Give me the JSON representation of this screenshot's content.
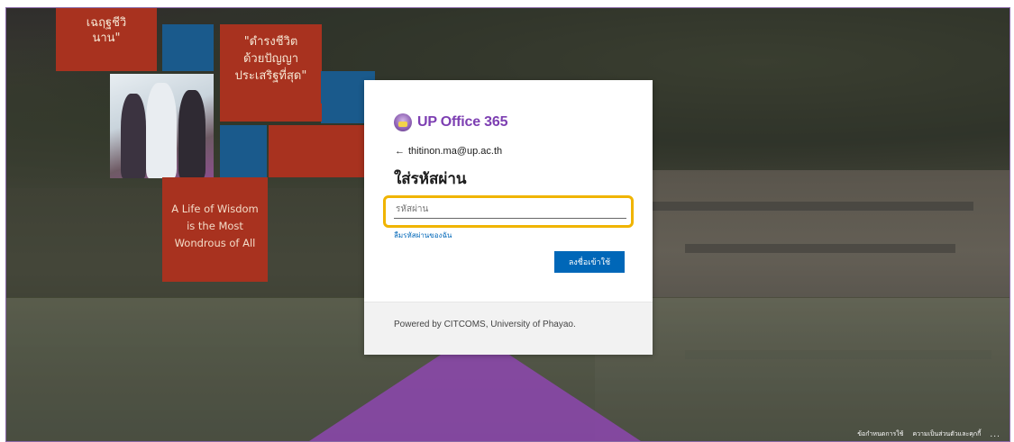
{
  "promo": {
    "line1": "เฉฤฐชีวิ\nนาน\"",
    "quote": "\"ดำรงชีวิต\nด้วยปัญญา\nประเสริฐที่สุด\"",
    "english": "A Life of Wisdom\nis the Most\nWondrous of All"
  },
  "login": {
    "brand": "UP Office 365",
    "back_arrow": "←",
    "email": "thitinon.ma@up.ac.th",
    "title": "ใส่รหัสผ่าน",
    "password_placeholder": "รหัสผ่าน",
    "password_value": "",
    "forgot_link": "ลืมรหัสผ่านของฉัน",
    "signin_button": "ลงชื่อเข้าใช้",
    "footer_text": "Powered by CITCOMS, University of Phayao."
  },
  "footer": {
    "terms": "ข้อกำหนดการใช้",
    "privacy": "ความเป็นส่วนตัวและคุกกี้",
    "more": "..."
  },
  "colors": {
    "brand_purple": "#7d3fb2",
    "primary_blue": "#0067b8",
    "highlight": "#f0b400",
    "promo_red": "#a8321f",
    "promo_blue": "#1a5a8c"
  }
}
